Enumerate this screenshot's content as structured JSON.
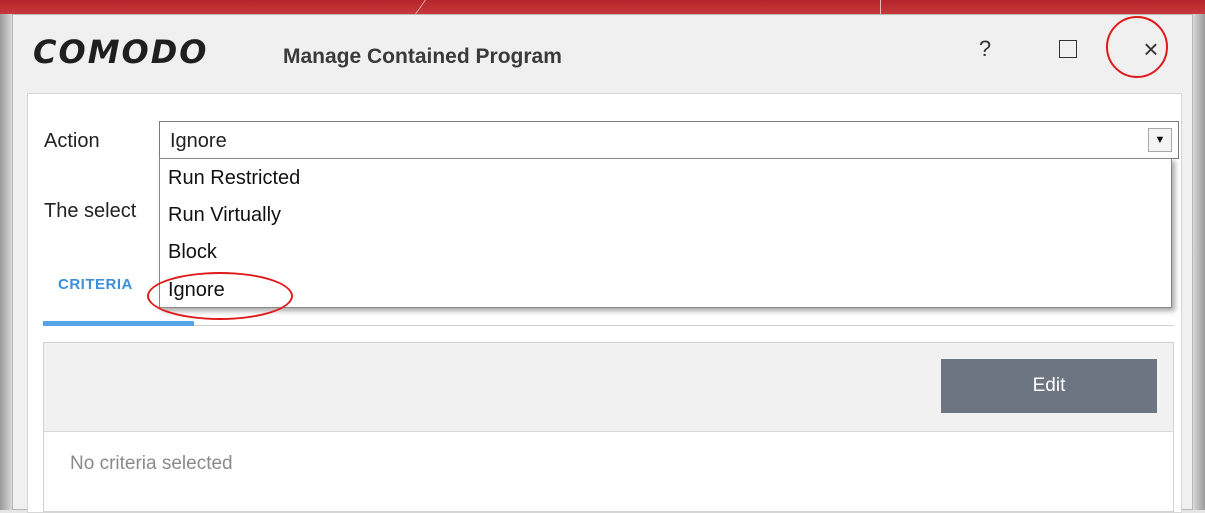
{
  "window": {
    "brand": "COMODO",
    "title": "Manage Contained Program",
    "help_symbol": "?",
    "close_symbol": "×"
  },
  "form": {
    "action_label": "Action",
    "action_value": "Ignore",
    "description_text": "The select",
    "dropdown_options": [
      "Run Restricted",
      "Run Virtually",
      "Block",
      "Ignore"
    ],
    "dropdown_selected": "Ignore"
  },
  "tabs": [
    {
      "label": "CRITERIA",
      "active": true
    }
  ],
  "criteria": {
    "edit_label": "Edit",
    "empty_text": "No criteria selected"
  },
  "annotations": {
    "highlight_color": "#e01a1a",
    "highlighted": [
      "dropdown-arrow",
      "Ignore"
    ]
  },
  "icons": {
    "help": "question-mark-icon",
    "maximize": "maximize-icon",
    "close": "close-icon",
    "dropdown": "triangle-down-icon"
  },
  "colors": {
    "accent_red": "#c8383a",
    "tab_blue": "#3d8fd8",
    "edit_button": "#6c7581"
  }
}
